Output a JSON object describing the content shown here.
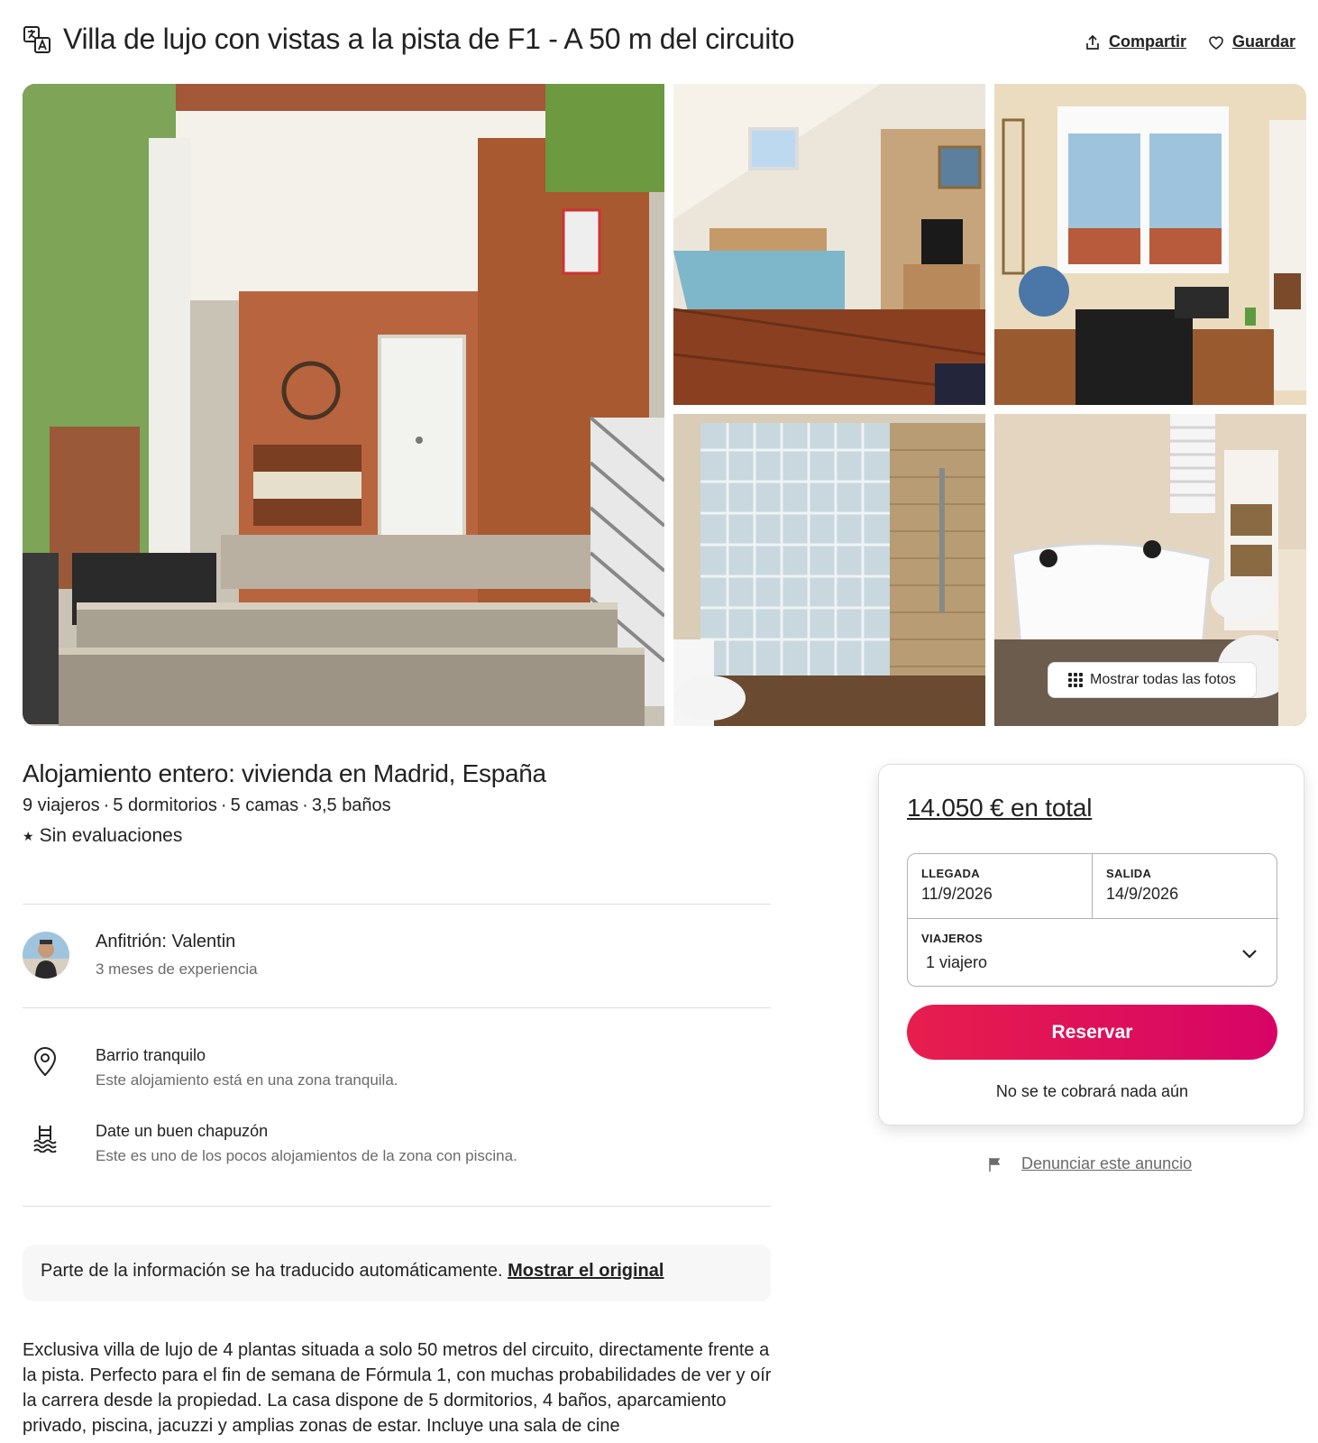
{
  "header": {
    "title": "Villa de lujo con vistas a la pista de F1 - A 50 m del circuito",
    "share_label": "Compartir",
    "save_label": "Guardar",
    "icons": [
      "translate-icon",
      "share-icon",
      "heart-icon"
    ]
  },
  "gallery": {
    "show_all_label": "Mostrar todas las fotos",
    "photos": [
      "entrance-porch",
      "bedroom",
      "study",
      "shower",
      "bathroom-jacuzzi"
    ]
  },
  "listing": {
    "type": "Alojamiento entero: vivienda en Madrid, España",
    "overview": {
      "guests": "9 viajeros",
      "bedrooms": "5 dormitorios",
      "beds": "5 camas",
      "baths": "3,5 baños"
    },
    "separator": "·",
    "reviews": "Sin evaluaciones",
    "star_glyph": "★"
  },
  "host": {
    "name": "Anfitrión: Valentin",
    "experience": "3 meses de experiencia"
  },
  "highlights": [
    {
      "icon": "location-pin-icon",
      "title": "Barrio tranquilo",
      "desc": "Este alojamiento está en una zona tranquila."
    },
    {
      "icon": "pool-icon",
      "title": "Date un buen chapuzón",
      "desc": "Este es uno de los pocos alojamientos de la zona con piscina."
    }
  ],
  "translation_notice": {
    "text": "Parte de la información se ha traducido automáticamente.",
    "link": "Mostrar el original"
  },
  "description": "Exclusiva villa de lujo de 4 plantas situada a solo 50 metros del circuito, directamente frente a la pista. Perfecto para el fin de semana de Fórmula 1, con muchas probabilidades de ver y oír la carrera desde la propiedad. La casa dispone de 5 dormitorios, 4 baños, aparcamiento privado, piscina, jacuzzi y amplias zonas de estar. Incluye una sala de cine",
  "booking": {
    "price": "14.050 € en total",
    "checkin_label": "LLEGADA",
    "checkin_value": "11/9/2026",
    "checkout_label": "SALIDA",
    "checkout_value": "14/9/2026",
    "guests_label": "VIAJEROS",
    "guests_value": "1 viajero",
    "reserve_label": "Reservar",
    "no_charge": "No se te cobrará nada aún",
    "accent_color": "#e61e4d"
  },
  "report": {
    "label": "Denunciar este anuncio",
    "icon": "flag-icon"
  }
}
